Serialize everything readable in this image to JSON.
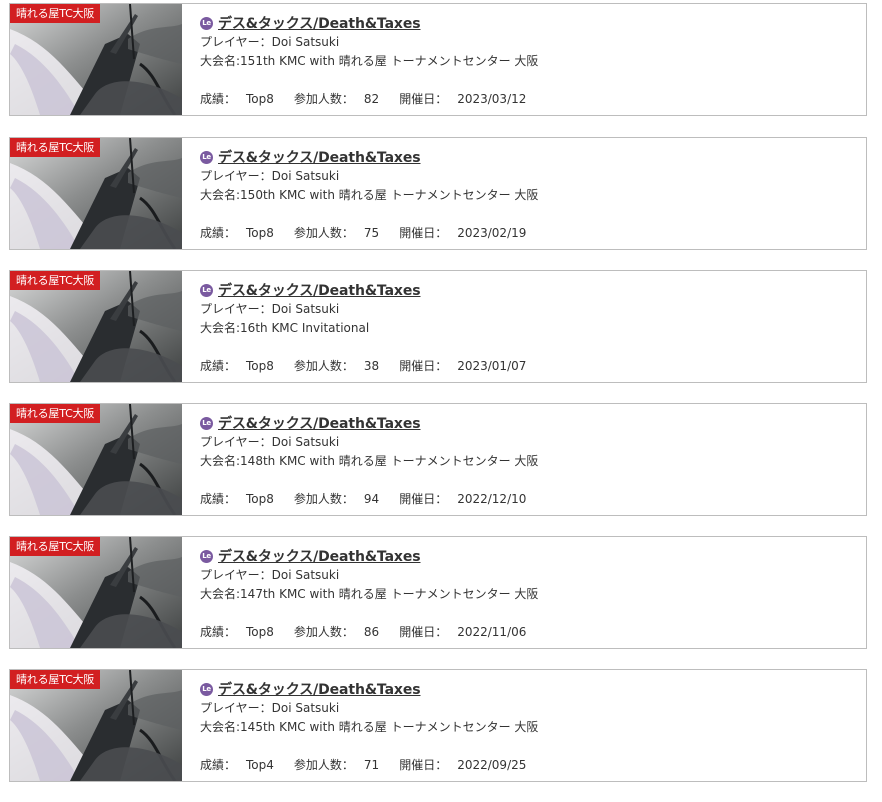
{
  "colors": {
    "event_tag_bg": "#d21f21",
    "format_icon_bg": "#7a5aa0",
    "card_border": "#bdbdbd",
    "text": "#333333"
  },
  "labels": {
    "player_prefix": "プレイヤー：",
    "event_prefix": "大会名:",
    "result_prefix": "成績：",
    "participants_prefix": "参加人数：",
    "date_prefix": "開催日："
  },
  "results": [
    {
      "tag": "晴れる屋TC大阪",
      "format_icon": "Le",
      "format_icon_name": "legacy-icon",
      "deck": "デス&タックス/Death&Taxes",
      "player": "Doi Satsuki",
      "event": "151th KMC with 晴れる屋 トーナメントセンター 大阪",
      "result": "Top8",
      "participants": "82",
      "date": "2023/03/12"
    },
    {
      "tag": "晴れる屋TC大阪",
      "format_icon": "Le",
      "format_icon_name": "legacy-icon",
      "deck": "デス&タックス/Death&Taxes",
      "player": "Doi Satsuki",
      "event": "150th KMC with 晴れる屋 トーナメントセンター 大阪",
      "result": "Top8",
      "participants": "75",
      "date": "2023/02/19"
    },
    {
      "tag": "晴れる屋TC大阪",
      "format_icon": "Le",
      "format_icon_name": "legacy-icon",
      "deck": "デス&タックス/Death&Taxes",
      "player": "Doi Satsuki",
      "event": "16th KMC Invitational",
      "result": "Top8",
      "participants": "38",
      "date": "2023/01/07"
    },
    {
      "tag": "晴れる屋TC大阪",
      "format_icon": "Le",
      "format_icon_name": "legacy-icon",
      "deck": "デス&タックス/Death&Taxes",
      "player": "Doi Satsuki",
      "event": "148th KMC with 晴れる屋 トーナメントセンター 大阪",
      "result": "Top8",
      "participants": "94",
      "date": "2022/12/10"
    },
    {
      "tag": "晴れる屋TC大阪",
      "format_icon": "Le",
      "format_icon_name": "legacy-icon",
      "deck": "デス&タックス/Death&Taxes",
      "player": "Doi Satsuki",
      "event": "147th KMC with 晴れる屋 トーナメントセンター 大阪",
      "result": "Top8",
      "participants": "86",
      "date": "2022/11/06"
    },
    {
      "tag": "晴れる屋TC大阪",
      "format_icon": "Le",
      "format_icon_name": "legacy-icon",
      "deck": "デス&タックス/Death&Taxes",
      "player": "Doi Satsuki",
      "event": "145th KMC with 晴れる屋 トーナメントセンター 大阪",
      "result": "Top4",
      "participants": "71",
      "date": "2022/09/25"
    }
  ]
}
